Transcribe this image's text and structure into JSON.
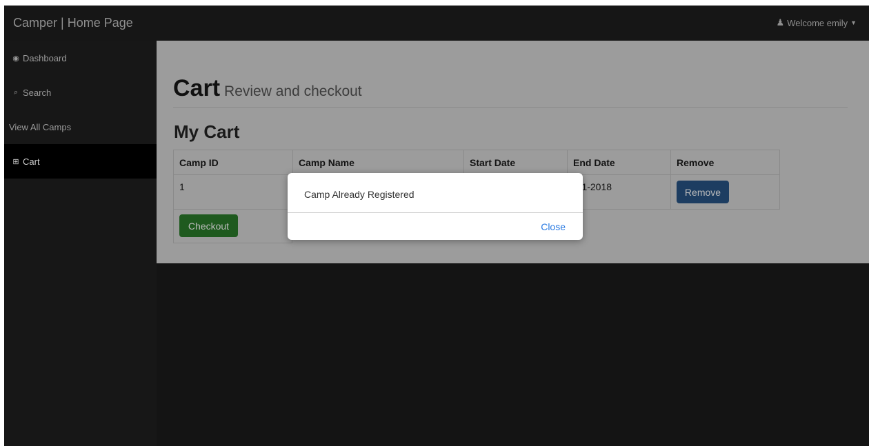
{
  "navbar": {
    "brand": "Camper | Home Page",
    "user_label": "Welcome emily",
    "user_icon": "user-icon",
    "caret_icon": "caret-down-icon"
  },
  "sidebar": {
    "items": [
      {
        "label": "Dashboard",
        "icon": "dashboard-icon",
        "glyph": "◉"
      },
      {
        "label": "Search",
        "icon": "search-icon",
        "glyph": "⌕"
      },
      {
        "label": "View All Camps",
        "icon": "",
        "glyph": ""
      },
      {
        "label": "Cart",
        "icon": "cart-icon",
        "glyph": "⊞",
        "active": true
      }
    ]
  },
  "page": {
    "title": "Cart",
    "subtitle": "Review and checkout",
    "section_title": "My Cart"
  },
  "table": {
    "headers": [
      "Camp ID",
      "Camp Name",
      "Start Date",
      "End Date",
      "Remove"
    ],
    "rows": [
      {
        "camp_id": "1",
        "camp_name": "",
        "start_date": "",
        "end_date": "-31-2018",
        "remove_label": "Remove"
      }
    ],
    "checkout_label": "Checkout"
  },
  "modal": {
    "message": "Camp Already Registered",
    "close_label": "Close"
  },
  "colors": {
    "remove_button": "#1d3d61",
    "checkout_button": "#1f5a1f",
    "modal_link": "#2a7ae2"
  }
}
